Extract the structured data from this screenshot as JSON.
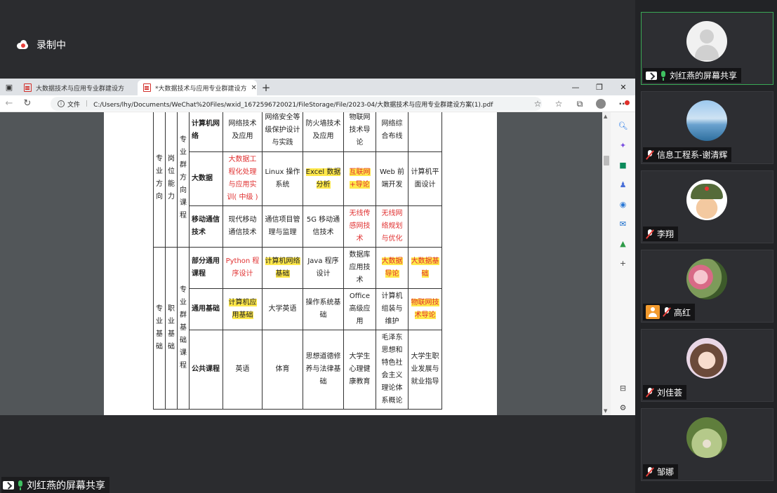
{
  "recording": {
    "label": "录制中"
  },
  "browser": {
    "tabs": [
      {
        "title": "大数据技术与应用专业群建设方"
      },
      {
        "title": "*大数据技术与应用专业群建设方"
      }
    ],
    "address": {
      "prefix": "文件",
      "url": "C:/Users/lhy/Documents/WeChat%20Files/wxid_1672596720021/FileStorage/File/2023-04/大数据技术与应用专业群建设方案(1).pdf"
    }
  },
  "table": {
    "group1": {
      "col_a": "专业方向",
      "col_b": "岗位能力",
      "col_c": "专业群方向课程",
      "rows": [
        {
          "cat": "计算机网络",
          "cells": [
            {
              "t": "网络技术及应用"
            },
            {
              "t": "网络安全等级保护设计与实践"
            },
            {
              "t": "防火墙技术及应用"
            },
            {
              "t": "物联网技术导论"
            },
            {
              "t": "网络综合布线"
            },
            {
              "t": ""
            }
          ]
        },
        {
          "cat": "大数据",
          "cells": [
            {
              "t": "大数据工程化处理与应用实训( 中级 )",
              "red": true
            },
            {
              "t": "Linux 操作系统"
            },
            {
              "t": "Excel 数据分析",
              "hl": true
            },
            {
              "t": "互联网+导论",
              "red": true,
              "hl": true
            },
            {
              "t": "Web 前端开发"
            },
            {
              "t": "计算机平面设计"
            }
          ]
        },
        {
          "cat": "移动通信技术",
          "cells": [
            {
              "t": "现代移动通信技术"
            },
            {
              "t": "通信项目管理与监理"
            },
            {
              "t": "5G 移动通信技术"
            },
            {
              "t": "无线传感网技术",
              "red": true
            },
            {
              "t": "无线网络规划与优化",
              "red": true
            },
            {
              "t": ""
            }
          ]
        }
      ]
    },
    "group2": {
      "col_a": "专业基础",
      "col_b": "职业基础",
      "col_c": "专业群基础课程",
      "rows": [
        {
          "cat": "部分通用课程",
          "cells": [
            {
              "t": "Python 程序设计",
              "red": true
            },
            {
              "t": "计算机网络基础",
              "hl": true
            },
            {
              "t": "Java 程序设计"
            },
            {
              "t": "数据库应用技术"
            },
            {
              "t": "大数据导论",
              "red": true,
              "hl": true
            },
            {
              "t": "大数据基础",
              "red": true,
              "hl": true
            }
          ]
        },
        {
          "cat": "通用基础",
          "cells": [
            {
              "t": "计算机应用基础",
              "hl": true
            },
            {
              "t": "大学英语"
            },
            {
              "t": "操作系统基础"
            },
            {
              "t": "Office 高级应用"
            },
            {
              "t": "计算机组装与维护"
            },
            {
              "t": "物联网技术导论",
              "red": true,
              "hl": true
            }
          ]
        },
        {
          "cat": "公共课程",
          "cells": [
            {
              "t": "英语"
            },
            {
              "t": "体育"
            },
            {
              "t": "思想道德修养与法律基础"
            },
            {
              "t": "大学生心理健康教育"
            },
            {
              "t": "毛泽东思想和特色社会主义理论体系概论"
            },
            {
              "t": "大学生职业发展与就业指导"
            }
          ]
        }
      ]
    }
  },
  "participants": [
    {
      "name": "刘红燕的屏幕共享",
      "type": "screen"
    },
    {
      "name": "信息工程系-谢清辉",
      "type": "muted"
    },
    {
      "name": "李翔",
      "type": "muted"
    },
    {
      "name": "高红",
      "type": "host"
    },
    {
      "name": "刘佳荟",
      "type": "muted"
    },
    {
      "name": "邹娜",
      "type": "muted"
    }
  ],
  "share_label": "刘红燕的屏幕共享",
  "colors": {
    "accent_green": "#3fc060",
    "mute_red": "#e8403b",
    "highlight": "#ffe84a",
    "red_text": "#e03030"
  }
}
